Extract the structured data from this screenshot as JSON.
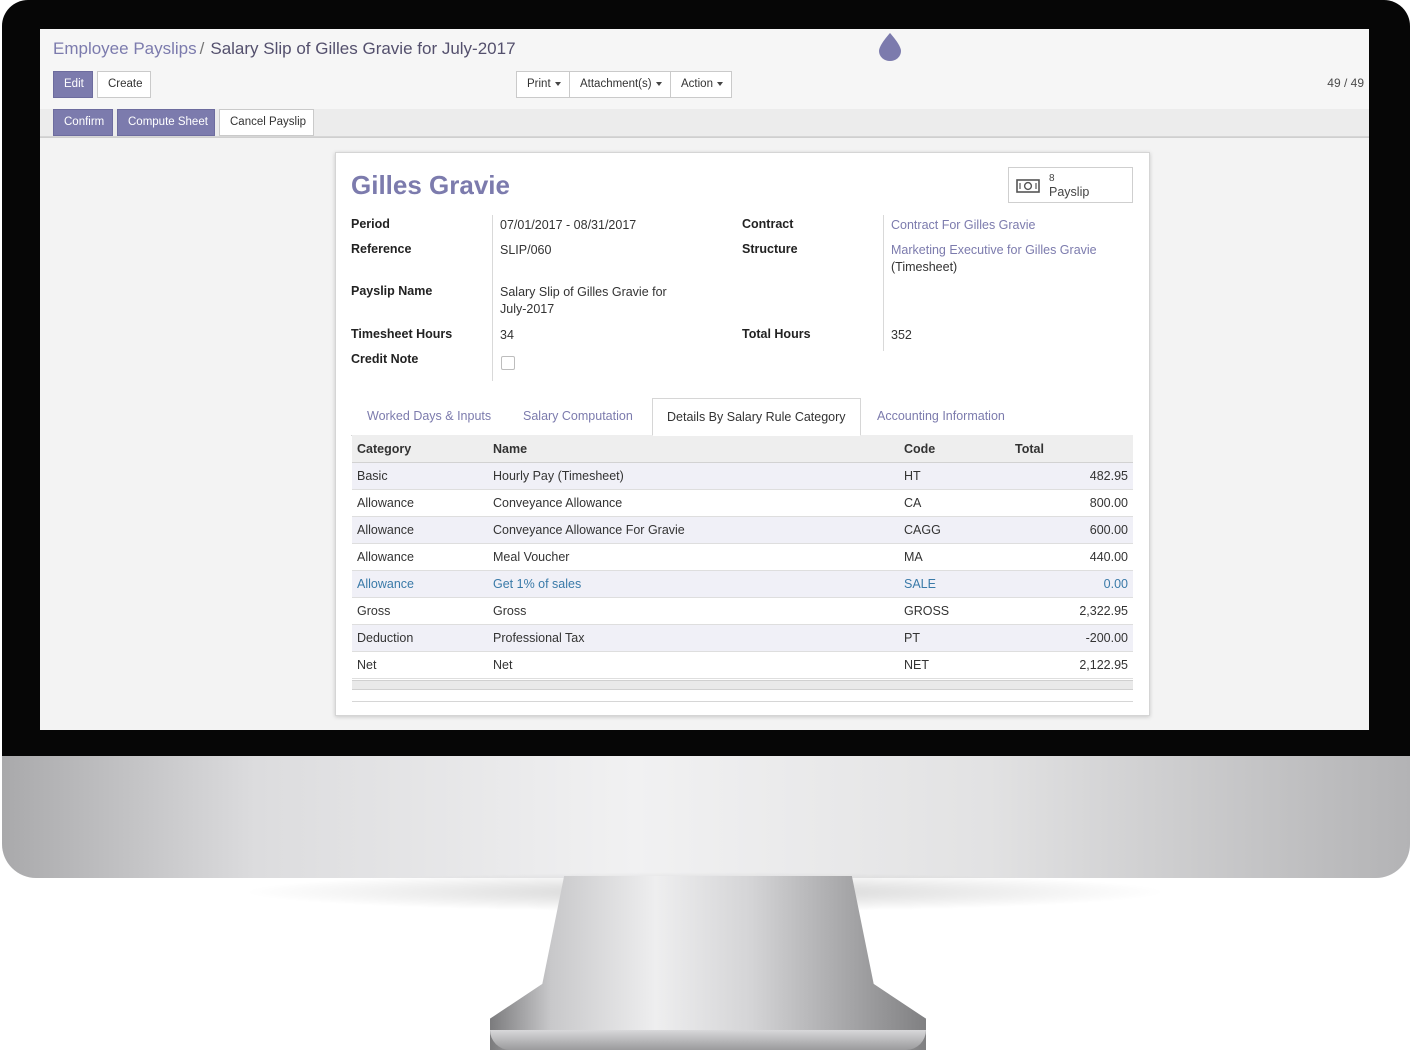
{
  "breadcrumb": {
    "parent": "Employee Payslips",
    "separator": "/",
    "current": "Salary Slip of Gilles Gravie for July-2017"
  },
  "toolbar": {
    "edit": "Edit",
    "create": "Create",
    "print": "Print",
    "attachments": "Attachment(s)",
    "action": "Action",
    "pager": "49 / 49"
  },
  "statusbar": {
    "confirm": "Confirm",
    "compute_sheet": "Compute Sheet",
    "cancel_payslip": "Cancel Payslip"
  },
  "form": {
    "employee_name": "Gilles Gravie",
    "smart_button": {
      "count": "8",
      "label": "Payslip",
      "icon": "money-icon"
    },
    "fields": {
      "period_label": "Period",
      "period_value": "07/01/2017 - 08/31/2017",
      "reference_label": "Reference",
      "reference_value": "SLIP/060",
      "payslip_name_label": "Payslip Name",
      "payslip_name_value": "Salary Slip of Gilles Gravie for July-2017",
      "timesheet_hours_label": "Timesheet Hours",
      "timesheet_hours_value": "34",
      "credit_note_label": "Credit Note",
      "credit_note_checked": false,
      "contract_label": "Contract",
      "contract_value": "Contract For Gilles Gravie",
      "structure_label": "Structure",
      "structure_value": "Marketing Executive for Gilles Gravie",
      "structure_sub": "(Timesheet)",
      "total_hours_label": "Total Hours",
      "total_hours_value": "352"
    },
    "tabs": [
      {
        "label": "Worked Days & Inputs",
        "active": false
      },
      {
        "label": "Salary Computation",
        "active": false
      },
      {
        "label": "Details By Salary Rule Category",
        "active": true
      },
      {
        "label": "Accounting Information",
        "active": false
      }
    ],
    "table": {
      "headers": [
        "Category",
        "Name",
        "Code",
        "Total"
      ],
      "rows": [
        {
          "category": "Basic",
          "name": "Hourly Pay (Timesheet)",
          "code": "HT",
          "total": "482.95"
        },
        {
          "category": "Allowance",
          "name": "Conveyance Allowance",
          "code": "CA",
          "total": "800.00"
        },
        {
          "category": "Allowance",
          "name": "Conveyance Allowance For Gravie",
          "code": "CAGG",
          "total": "600.00"
        },
        {
          "category": "Allowance",
          "name": "Meal Voucher",
          "code": "MA",
          "total": "440.00"
        },
        {
          "category": "Allowance",
          "name": "Get 1% of sales",
          "code": "SALE",
          "total": "0.00"
        },
        {
          "category": "Gross",
          "name": "Gross",
          "code": "GROSS",
          "total": "2,322.95"
        },
        {
          "category": "Deduction",
          "name": "Professional Tax",
          "code": "PT",
          "total": "-200.00"
        },
        {
          "category": "Net",
          "name": "Net",
          "code": "NET",
          "total": "2,122.95"
        }
      ]
    }
  },
  "colors": {
    "brand": "#7c7bad",
    "info_row": "#3a7aa8",
    "odd_row": "#f0f0f7"
  }
}
